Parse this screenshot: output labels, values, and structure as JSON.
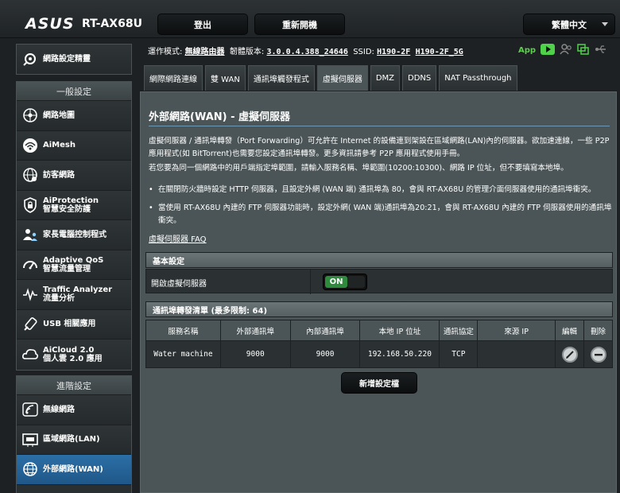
{
  "header": {
    "brand": "ASUS",
    "model": "RT-AX68U",
    "logout_label": "登出",
    "reboot_label": "重新開機",
    "language": "繁體中文"
  },
  "status": {
    "mode_label": "運作模式:",
    "mode_value": "無線路由器",
    "firmware_label": "韌體版本:",
    "firmware_value": "3.0.0.4.388_24646",
    "ssid_label": "SSID:",
    "ssid_1": "H190-2F",
    "ssid_2": "H190-2F_5G",
    "app_label": "App",
    "icons": [
      "play-icon",
      "users-icon",
      "copy-icon",
      "usb-icon"
    ]
  },
  "sidebar": {
    "quick_setup": "網路設定精靈",
    "general_head": "一般設定",
    "general_items": [
      {
        "label": "網路地圖",
        "label2": "",
        "icon": "network-map-icon"
      },
      {
        "label": "AiMesh",
        "label2": "",
        "icon": "aimesh-icon"
      },
      {
        "label": "訪客網路",
        "label2": "",
        "icon": "guest-network-icon"
      },
      {
        "label": "AiProtection",
        "label2": "智慧安全防護",
        "icon": "shield-icon"
      },
      {
        "label": "家長電腦控制程式",
        "label2": "",
        "icon": "parental-control-icon"
      },
      {
        "label": "Adaptive QoS",
        "label2": "智慧流量管理",
        "icon": "gauge-icon"
      },
      {
        "label": "Traffic Analyzer",
        "label2": "流量分析",
        "icon": "analyzer-icon"
      },
      {
        "label": "USB 相關應用",
        "label2": "",
        "icon": "usb-icon"
      },
      {
        "label": "AiCloud 2.0",
        "label2": "個人雲 2.0 應用",
        "icon": "cloud-icon"
      }
    ],
    "advanced_head": "進階設定",
    "advanced_items": [
      {
        "label": "無線網路",
        "icon": "wifi-icon",
        "active": false
      },
      {
        "label": "區域網路(LAN)",
        "icon": "lan-icon",
        "active": false
      },
      {
        "label": "外部網路(WAN)",
        "icon": "globe-icon",
        "active": true
      }
    ]
  },
  "tabs": [
    "網際網路連線",
    "雙 WAN",
    "通訊埠觸發程式",
    "虛擬伺服器",
    "DMZ",
    "DDNS",
    "NAT Passthrough"
  ],
  "active_tab": "虛擬伺服器",
  "page": {
    "title": "外部網路(WAN) - 虛擬伺服器",
    "desc1": "虛擬伺服器 / 通訊埠轉發（Port Forwarding）可允許在 Internet 的設備連到架設在區域網路(LAN)內的伺服器。欲加速連線，一些 P2P 應用程式(如 BitTorrent)也需要您設定通訊埠轉發。更多資訊請參考 P2P 應用程式使用手冊。",
    "desc2": "若您要為同一個網路中的用戶端指定埠範圍，請輸入服務名稱、埠範圍(10200:10300)、網路 IP 位址，但不要填寫本地埠。",
    "bullet1": "在關閉防火牆時設定 HTTP 伺服器，且設定外網 (WAN 端) 通訊埠為 80，會與 RT-AX68U 的管理介面伺服器使用的通訊埠衝突。",
    "bullet2": "當使用 RT-AX68U 內建的 FTP 伺服器功能時，設定外網( WAN 端)通訊埠為20:21，會與 RT-AX68U 內建的 FTP 伺服器使用的通訊埠衝突。",
    "faq_link": "虛擬伺服器 FAQ",
    "basic_head": "基本設定",
    "enable_label": "開啟虛擬伺服器",
    "toggle_state": "ON",
    "list_head": "通訊埠轉發清單 (最多限制: 64)",
    "columns": [
      "服務名稱",
      "外部通訊埠",
      "內部通訊埠",
      "本地 IP 位址",
      "通訊協定",
      "來源 IP",
      "編輯",
      "刪除"
    ],
    "rows": [
      {
        "service": "Water machine",
        "ext_port": "9000",
        "int_port": "9000",
        "ip": "192.168.50.220",
        "protocol": "TCP",
        "source_ip": ""
      }
    ],
    "add_label": "新增設定檔"
  }
}
